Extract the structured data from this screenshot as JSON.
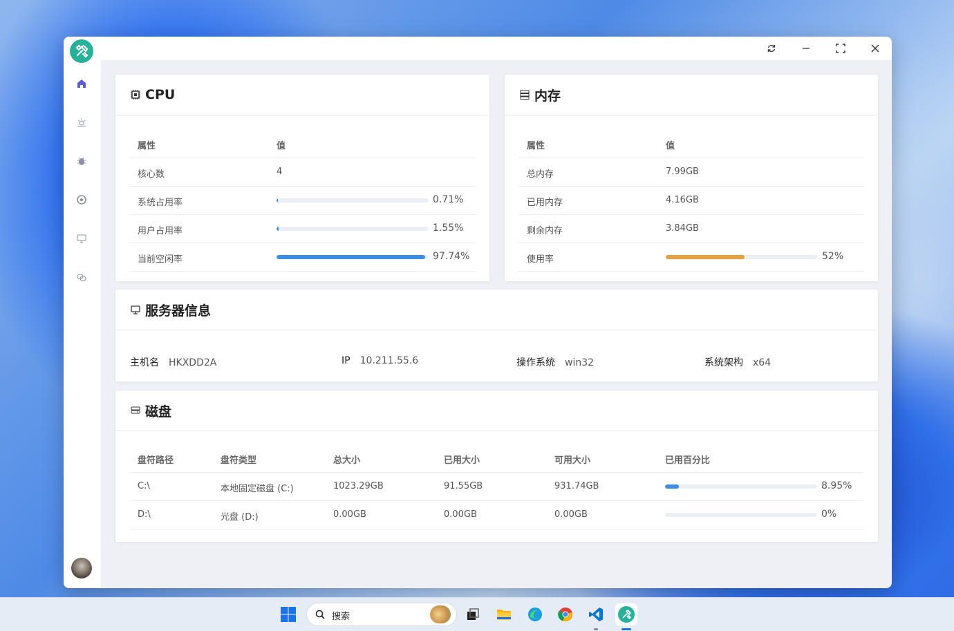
{
  "search": {
    "placeholder": "搜索"
  },
  "cpu": {
    "title": "CPU",
    "col_attr": "属性",
    "col_val": "值",
    "rows": [
      {
        "label": "核心数",
        "value": "4"
      },
      {
        "label": "系统占用率",
        "value": "0.71%",
        "progress": 0.0071
      },
      {
        "label": "用户占用率",
        "value": "1.55%",
        "progress": 0.0155
      },
      {
        "label": "当前空闲率",
        "value": "97.74%",
        "progress": 0.9774
      }
    ]
  },
  "memory": {
    "title": "内存",
    "col_attr": "属性",
    "col_val": "值",
    "rows": [
      {
        "label": "总内存",
        "value": "7.99GB"
      },
      {
        "label": "已用内存",
        "value": "4.16GB"
      },
      {
        "label": "剩余内存",
        "value": "3.84GB"
      },
      {
        "label": "使用率",
        "value": "52%",
        "progress": 0.52
      }
    ]
  },
  "server": {
    "title": "服务器信息",
    "items": [
      {
        "label": "主机名",
        "value": "HKXDD2A"
      },
      {
        "label": "IP",
        "value": "10.211.55.6"
      },
      {
        "label": "操作系统",
        "value": "win32"
      },
      {
        "label": "系统架构",
        "value": "x64"
      }
    ]
  },
  "disk": {
    "title": "磁盘",
    "headers": [
      "盘符路径",
      "盘符类型",
      "总大小",
      "已用大小",
      "可用大小",
      "已用百分比"
    ],
    "rows": [
      {
        "path": "C:\\",
        "type": "本地固定磁盘 (C:)",
        "total": "1023.29GB",
        "used": "91.55GB",
        "free": "931.74GB",
        "percent": "8.95%",
        "progress": 0.0895
      },
      {
        "path": "D:\\",
        "type": "光盘 (D:)",
        "total": "0.00GB",
        "used": "0.00GB",
        "free": "0.00GB",
        "percent": "0%",
        "progress": 0
      }
    ]
  },
  "colors": {
    "accent": "#3a8ee6",
    "memory_bar": "#e6a23c",
    "logo": "#28b19a",
    "nav_active": "#5b5fd6"
  }
}
